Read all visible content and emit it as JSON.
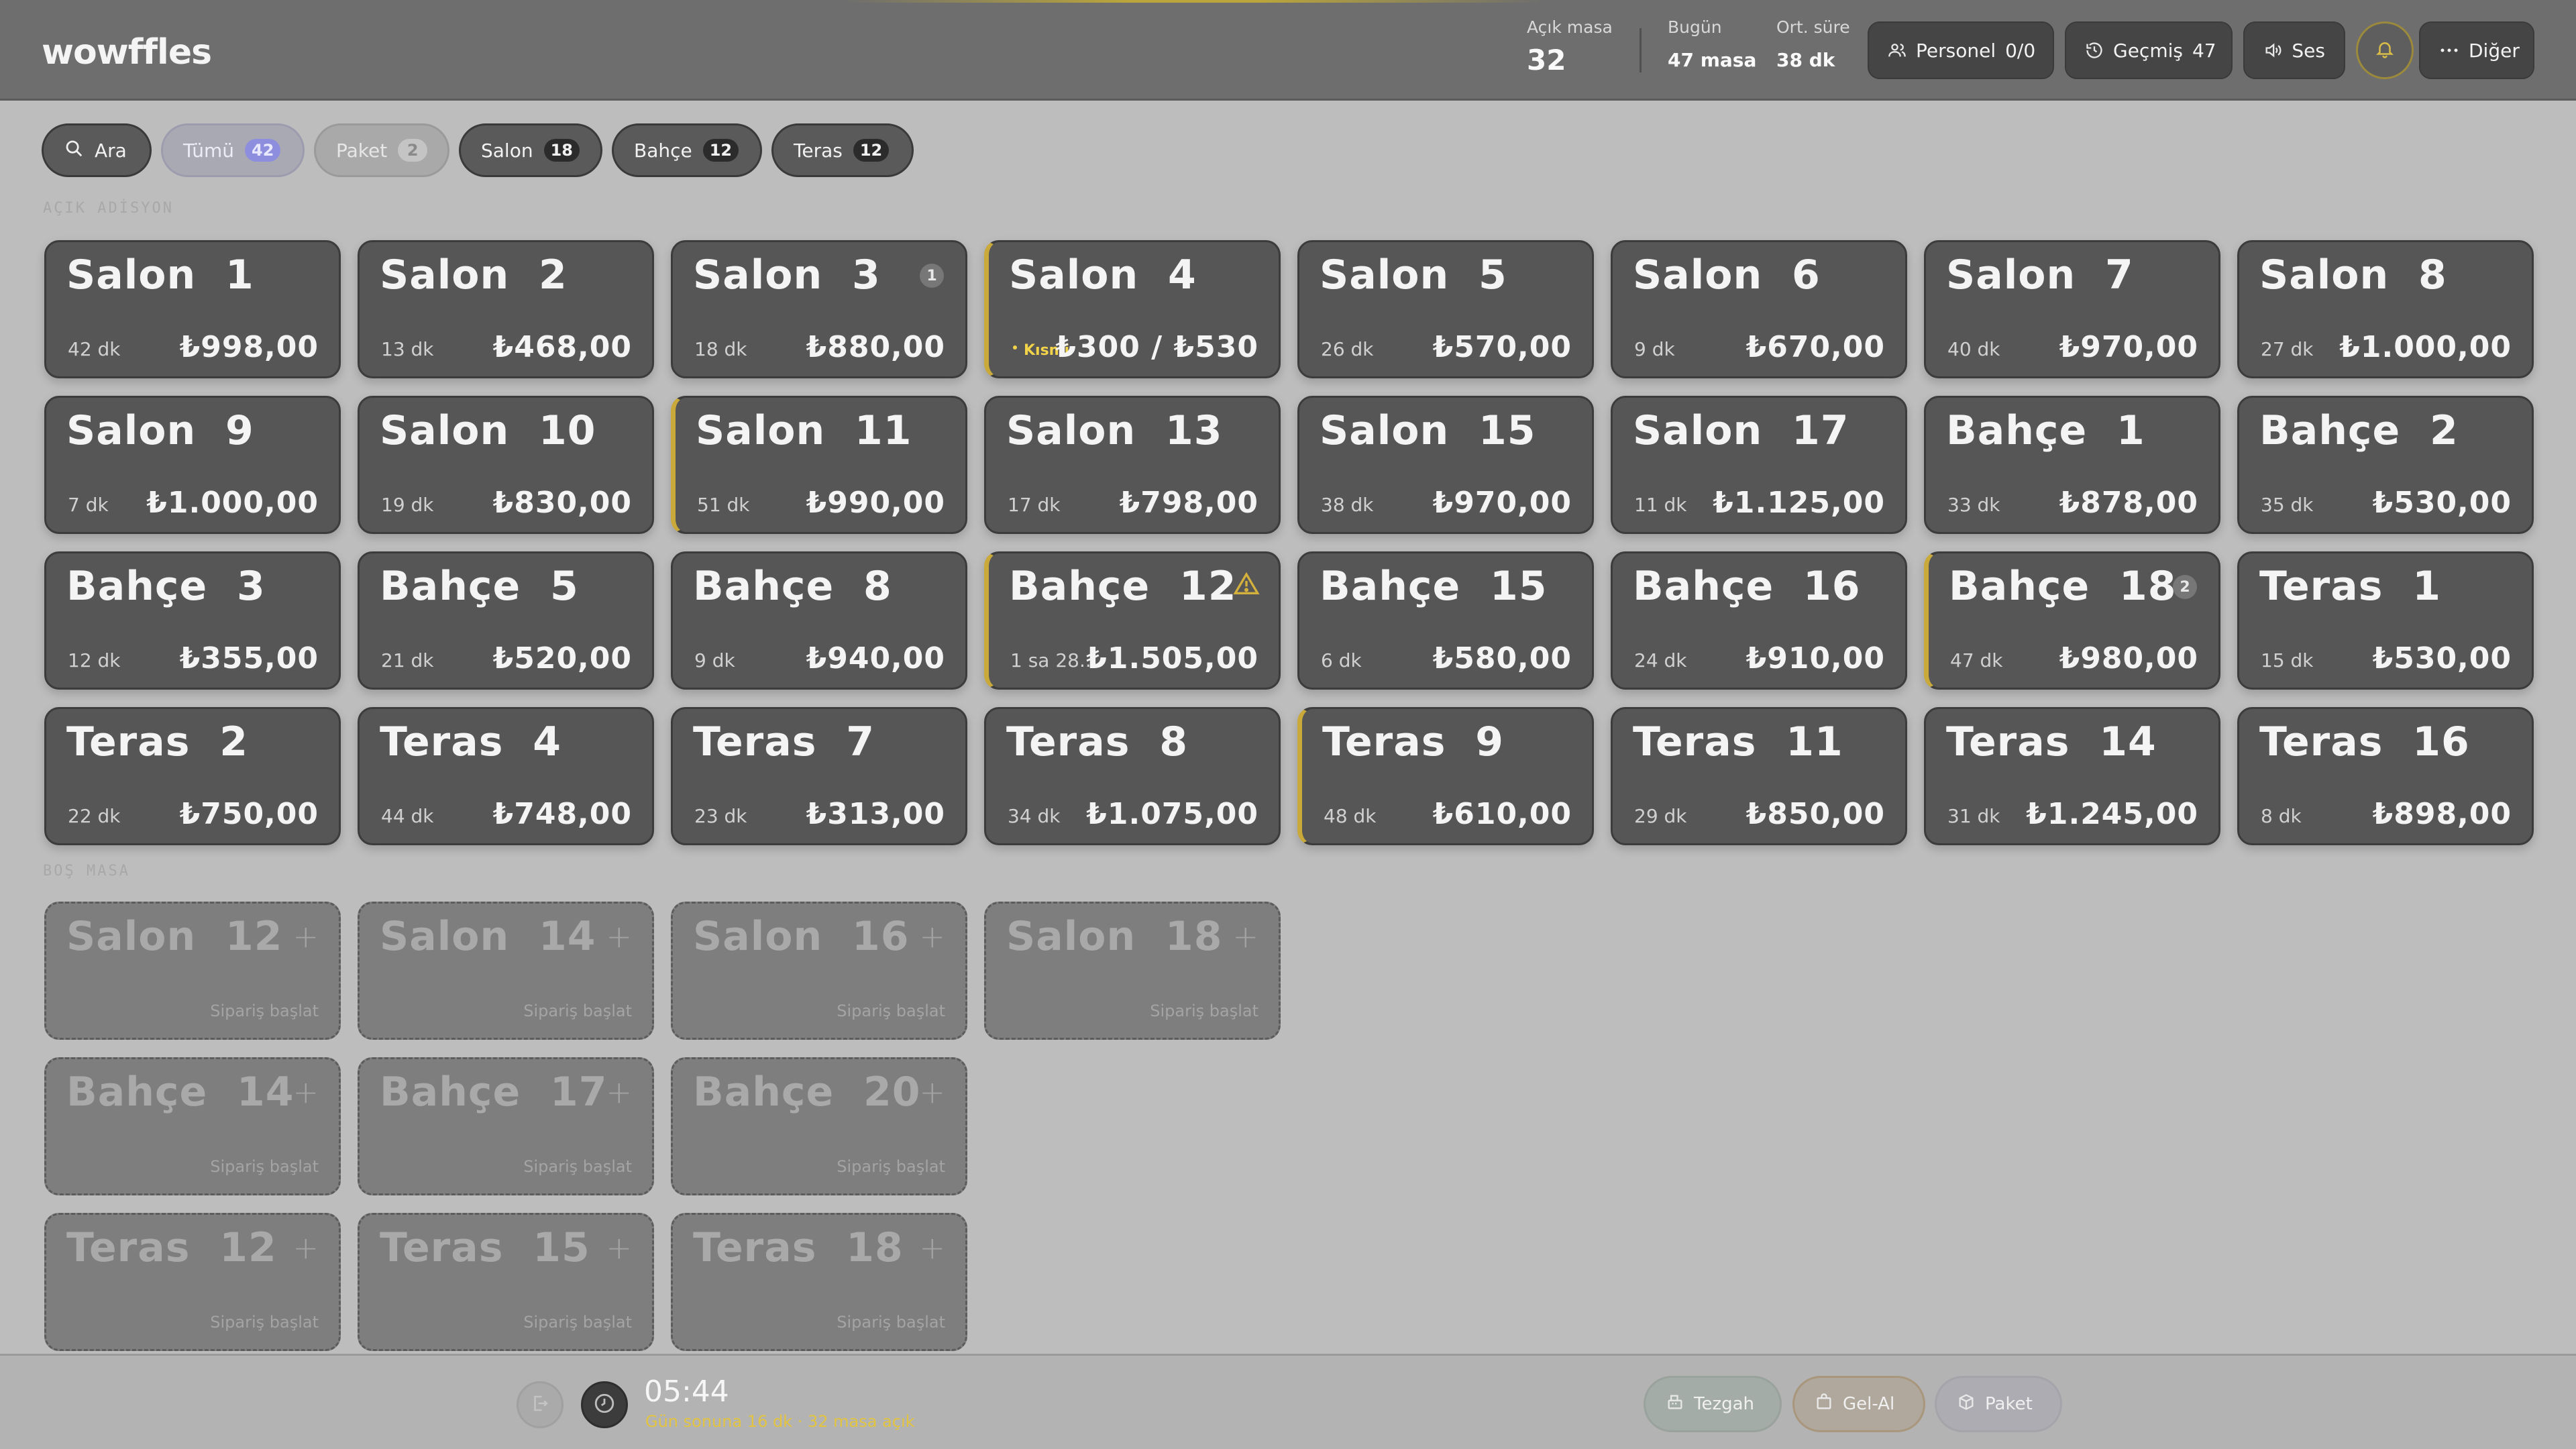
{
  "app": {
    "logo": "wowffles"
  },
  "header": {
    "open_tables_label": "Açık masa",
    "open_tables_value": "32",
    "today_label": "Bugün",
    "today_value": "47 masa",
    "avg_label": "Ort. süre",
    "avg_value": "38 dk",
    "staff_label": "Personel",
    "staff_count": "0/0",
    "history_label": "Geçmiş",
    "history_count": "47",
    "sound_label": "Ses",
    "more_label": "Diğer"
  },
  "filters": {
    "search_label": "Ara",
    "items": [
      {
        "label": "Tümü",
        "count": "42",
        "state": "active"
      },
      {
        "label": "Paket",
        "count": "2",
        "state": "light"
      },
      {
        "label": "Salon",
        "count": "18",
        "state": "dark"
      },
      {
        "label": "Bahçe",
        "count": "12",
        "state": "dark"
      },
      {
        "label": "Teras",
        "count": "12",
        "state": "dark"
      }
    ]
  },
  "sections": {
    "open_label": "AÇIK ADİSYON",
    "empty_label": "BOŞ MASA"
  },
  "open_tables": [
    {
      "name": "Salon  1",
      "duration": "42 dk",
      "amount": "₺998,00"
    },
    {
      "name": "Salon  2",
      "duration": "13 dk",
      "amount": "₺468,00"
    },
    {
      "name": "Salon  3",
      "duration": "18 dk",
      "amount": "₺880,00",
      "count": "1"
    },
    {
      "name": "Salon  4",
      "duration": "",
      "amount": "₺300 / ₺530",
      "warn": true,
      "partial": "Kısmi"
    },
    {
      "name": "Salon  5",
      "duration": "26 dk",
      "amount": "₺570,00"
    },
    {
      "name": "Salon  6",
      "duration": "9 dk",
      "amount": "₺670,00"
    },
    {
      "name": "Salon  7",
      "duration": "40 dk",
      "amount": "₺970,00"
    },
    {
      "name": "Salon  8",
      "duration": "27 dk",
      "amount": "₺1.000,00"
    },
    {
      "name": "Salon  9",
      "duration": "7 dk",
      "amount": "₺1.000,00"
    },
    {
      "name": "Salon  10",
      "duration": "19 dk",
      "amount": "₺830,00"
    },
    {
      "name": "Salon  11",
      "duration": "51 dk",
      "amount": "₺990,00",
      "warn": true
    },
    {
      "name": "Salon  13",
      "duration": "17 dk",
      "amount": "₺798,00"
    },
    {
      "name": "Salon  15",
      "duration": "38 dk",
      "amount": "₺970,00"
    },
    {
      "name": "Salon  17",
      "duration": "11 dk",
      "amount": "₺1.125,00"
    },
    {
      "name": "Bahçe  1",
      "duration": "33 dk",
      "amount": "₺878,00"
    },
    {
      "name": "Bahçe  2",
      "duration": "35 dk",
      "amount": "₺530,00"
    },
    {
      "name": "Bahçe  3",
      "duration": "12 dk",
      "amount": "₺355,00"
    },
    {
      "name": "Bahçe  5",
      "duration": "21 dk",
      "amount": "₺520,00"
    },
    {
      "name": "Bahçe  8",
      "duration": "9 dk",
      "amount": "₺940,00"
    },
    {
      "name": "Bahçe  12",
      "duration": "1 sa 28...",
      "amount": "₺1.505,00",
      "warn": true,
      "alert": true
    },
    {
      "name": "Bahçe  15",
      "duration": "6 dk",
      "amount": "₺580,00"
    },
    {
      "name": "Bahçe  16",
      "duration": "24 dk",
      "amount": "₺910,00"
    },
    {
      "name": "Bahçe  18",
      "duration": "47 dk",
      "amount": "₺980,00",
      "warn": true,
      "count": "2"
    },
    {
      "name": "Teras  1",
      "duration": "15 dk",
      "amount": "₺530,00"
    },
    {
      "name": "Teras  2",
      "duration": "22 dk",
      "amount": "₺750,00"
    },
    {
      "name": "Teras  4",
      "duration": "44 dk",
      "amount": "₺748,00"
    },
    {
      "name": "Teras  7",
      "duration": "23 dk",
      "amount": "₺313,00"
    },
    {
      "name": "Teras  8",
      "duration": "34 dk",
      "amount": "₺1.075,00"
    },
    {
      "name": "Teras  9",
      "duration": "48 dk",
      "amount": "₺610,00",
      "warn": true
    },
    {
      "name": "Teras  11",
      "duration": "29 dk",
      "amount": "₺850,00"
    },
    {
      "name": "Teras  14",
      "duration": "31 dk",
      "amount": "₺1.245,00"
    },
    {
      "name": "Teras  16",
      "duration": "8 dk",
      "amount": "₺898,00"
    }
  ],
  "empty_tables": {
    "start_label": "Sipariş başlat",
    "rows": [
      [
        "Salon  12",
        "Salon  14",
        "Salon  16",
        "Salon  18"
      ],
      [
        "Bahçe  14",
        "Bahçe  17",
        "Bahçe  20"
      ],
      [
        "Teras  12",
        "Teras  15",
        "Teras  18"
      ]
    ]
  },
  "footer": {
    "time": "05:44",
    "sub": "Gün sonuna 16 dk · 32 masa açık",
    "counter_label": "Tezgah",
    "takeaway_label": "Gel-Al",
    "package_label": "Paket"
  }
}
